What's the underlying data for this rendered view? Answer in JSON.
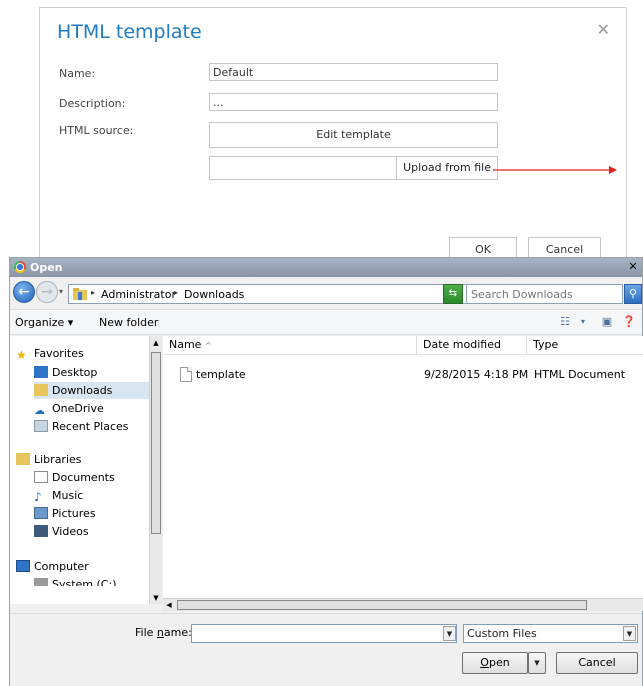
{
  "template_dialog": {
    "title": "HTML template",
    "close_icon": "close-icon",
    "name_label": "Name:",
    "name_value": "Default",
    "description_label": "Description:",
    "description_value": "...",
    "html_source_label": "HTML source:",
    "edit_template_label": "Edit template",
    "upload_label": "Upload from file",
    "ok_label": "OK",
    "cancel_label": "Cancel",
    "arrow_color": "#e0201f"
  },
  "open_dialog": {
    "title": "Open",
    "address": {
      "crumbs": [
        "Administrator",
        "Downloads"
      ]
    },
    "search_placeholder": "Search Downloads",
    "toolbar": {
      "organize_label": "Organize ▾",
      "new_folder_label": "New folder"
    },
    "nav": {
      "favorites": "Favorites",
      "desktop": "Desktop",
      "downloads": "Downloads",
      "onedrive": "OneDrive",
      "recent": "Recent Places",
      "libraries": "Libraries",
      "documents": "Documents",
      "music": "Music",
      "pictures": "Pictures",
      "videos": "Videos",
      "computer": "Computer",
      "system_c": "System (C:)"
    },
    "columns": {
      "name": "Name",
      "date": "Date modified",
      "type": "Type"
    },
    "files": [
      {
        "name": "template",
        "date": "9/28/2015 4:18 PM",
        "type": "HTML Document"
      }
    ],
    "file_name_label_prefix": "File ",
    "file_name_label_u": "n",
    "file_name_label_suffix": "ame:",
    "file_name_value": "",
    "file_type_value": "Custom Files",
    "open_label_u": "O",
    "open_label_rest": "pen",
    "cancel_label": "Cancel"
  }
}
